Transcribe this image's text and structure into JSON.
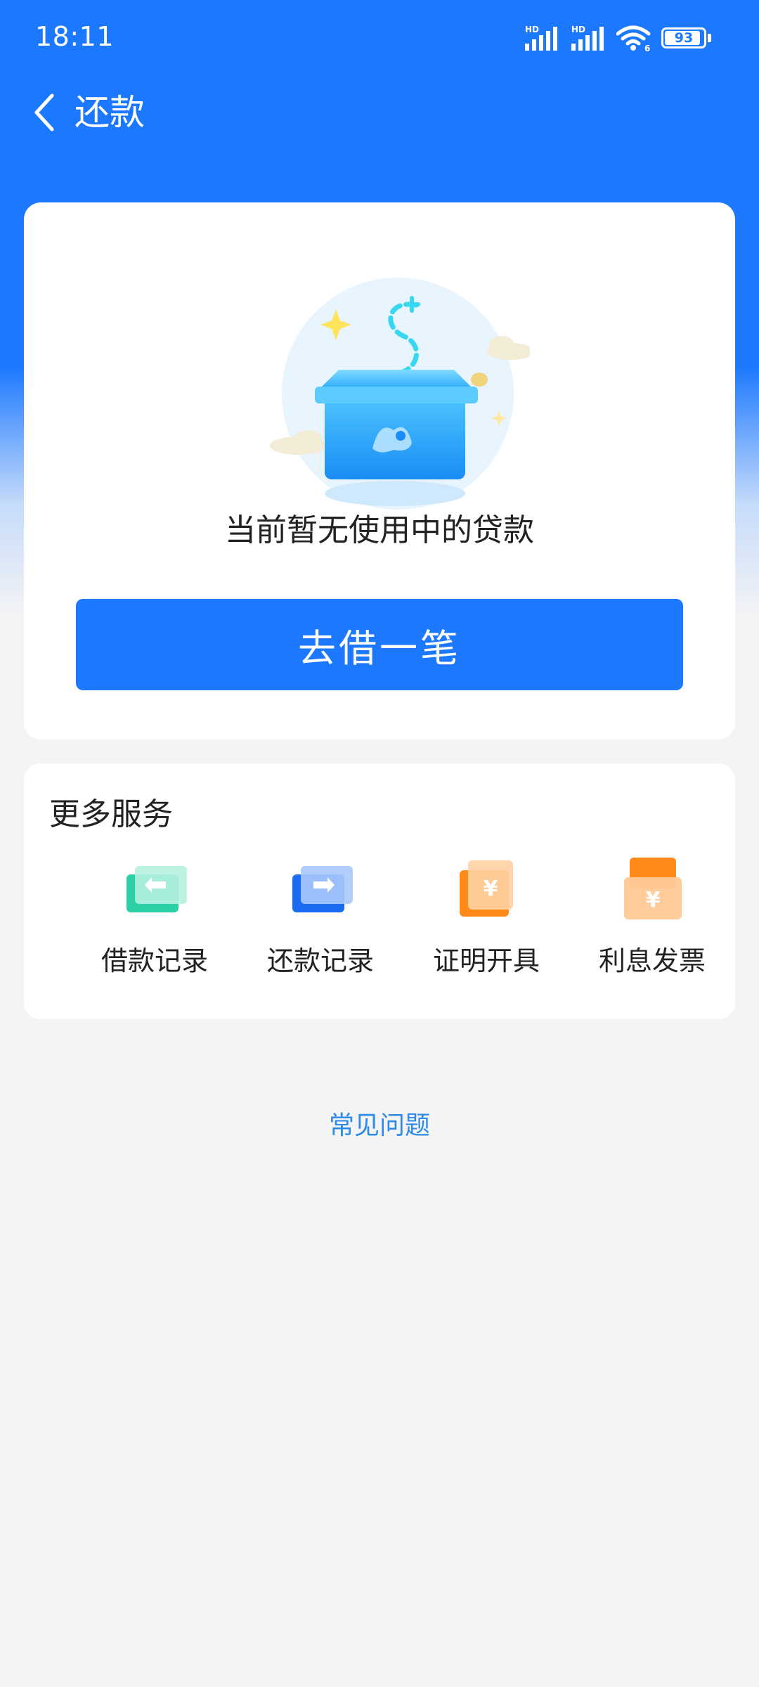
{
  "status_bar": {
    "time": "18:11",
    "signal_1_label": "HD",
    "signal_2_label": "HD",
    "wifi_label": "6",
    "battery": "93",
    "battery_level": 0.93
  },
  "header": {
    "title": "还款",
    "back_icon": "chevron-left-icon"
  },
  "main_card": {
    "empty_message": "当前暂无使用中的贷款",
    "borrow_button": "去借一笔",
    "illustration_icon": "empty-box-illustration"
  },
  "services": {
    "title": "更多服务",
    "items": [
      {
        "label": "借款记录",
        "icon": "borrow-record-icon",
        "color": "#2bd0a6"
      },
      {
        "label": "还款记录",
        "icon": "repay-record-icon",
        "color": "#1b6cf2"
      },
      {
        "label": "证明开具",
        "icon": "certificate-icon",
        "color": "#ff8a1a"
      },
      {
        "label": "利息发票",
        "icon": "invoice-icon",
        "color": "#ff8a1a"
      }
    ]
  },
  "faq": {
    "label": "常见问题"
  },
  "colors": {
    "brand_blue": "#1b78ff",
    "link_blue": "#2e8ae8",
    "background": "#f4f4f5"
  }
}
